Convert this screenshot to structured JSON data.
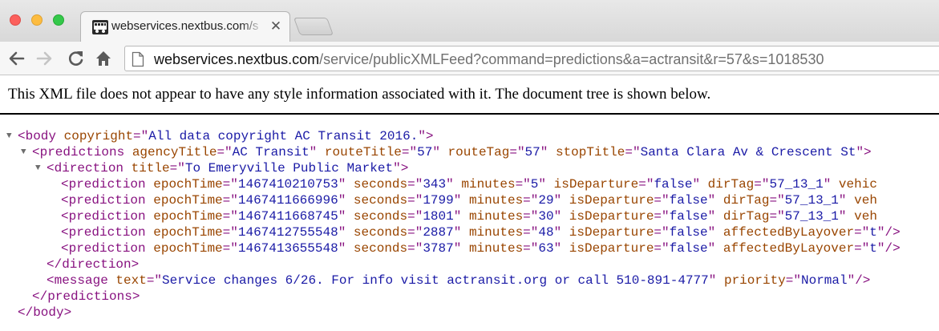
{
  "browser": {
    "tab": {
      "title": "webservices.nextbus.com/s",
      "close_glyph": "✕"
    },
    "address": {
      "host": "webservices.nextbus.com",
      "path": "/service/publicXMLFeed?command=predictions&a=actransit&r=57&s=1018530"
    },
    "icons": [
      "back-arrow-icon",
      "forward-arrow-icon",
      "reload-icon",
      "home-icon",
      "page-icon",
      "nextbus-favicon"
    ]
  },
  "page": {
    "notice": "This XML file does not appear to have any style information associated with it. The document tree is shown below.",
    "body_open": {
      "tag": "body",
      "attrs": [
        {
          "name": "copyright",
          "value": "All data copyright AC Transit 2016."
        }
      ]
    },
    "predictions_open": {
      "tag": "predictions",
      "attrs": [
        {
          "name": "agencyTitle",
          "value": "AC Transit"
        },
        {
          "name": "routeTitle",
          "value": "57"
        },
        {
          "name": "routeTag",
          "value": "57"
        },
        {
          "name": "stopTitle",
          "value": "Santa Clara Av & Crescent St"
        }
      ]
    },
    "direction_open": {
      "tag": "direction",
      "attrs": [
        {
          "name": "title",
          "value": "To Emeryville Public Market"
        }
      ]
    },
    "prediction_rows": [
      {
        "tag": "prediction",
        "attrs": [
          {
            "name": "epochTime",
            "value": "1467410210753"
          },
          {
            "name": "seconds",
            "value": "343"
          },
          {
            "name": "minutes",
            "value": "5"
          },
          {
            "name": "isDeparture",
            "value": "false"
          },
          {
            "name": "dirTag",
            "value": "57_13_1"
          }
        ],
        "trailing": "vehic"
      },
      {
        "tag": "prediction",
        "attrs": [
          {
            "name": "epochTime",
            "value": "1467411666996"
          },
          {
            "name": "seconds",
            "value": "1799"
          },
          {
            "name": "minutes",
            "value": "29"
          },
          {
            "name": "isDeparture",
            "value": "false"
          },
          {
            "name": "dirTag",
            "value": "57_13_1"
          }
        ],
        "trailing": "veh"
      },
      {
        "tag": "prediction",
        "attrs": [
          {
            "name": "epochTime",
            "value": "1467411668745"
          },
          {
            "name": "seconds",
            "value": "1801"
          },
          {
            "name": "minutes",
            "value": "30"
          },
          {
            "name": "isDeparture",
            "value": "false"
          },
          {
            "name": "dirTag",
            "value": "57_13_1"
          }
        ],
        "trailing": "veh"
      },
      {
        "tag": "prediction",
        "attrs": [
          {
            "name": "epochTime",
            "value": "1467412755548"
          },
          {
            "name": "seconds",
            "value": "2887"
          },
          {
            "name": "minutes",
            "value": "48"
          },
          {
            "name": "isDeparture",
            "value": "false"
          },
          {
            "name": "affectedByLayover",
            "value": "t"
          }
        ],
        "trailing": ""
      },
      {
        "tag": "prediction",
        "attrs": [
          {
            "name": "epochTime",
            "value": "1467413655548"
          },
          {
            "name": "seconds",
            "value": "3787"
          },
          {
            "name": "minutes",
            "value": "63"
          },
          {
            "name": "isDeparture",
            "value": "false"
          },
          {
            "name": "affectedByLayover",
            "value": "t"
          }
        ],
        "trailing": ""
      }
    ],
    "direction_close": "</direction>",
    "message": {
      "tag": "message",
      "attrs": [
        {
          "name": "text",
          "value": "Service changes 6/26. For info visit actransit.org or call 510-891-4777"
        },
        {
          "name": "priority",
          "value": "Normal"
        }
      ]
    },
    "predictions_close": "</predictions>",
    "body_close": "</body>"
  },
  "colors": {
    "tag": "#881280",
    "attr_name": "#994500",
    "attr_value": "#1a1aa6"
  }
}
